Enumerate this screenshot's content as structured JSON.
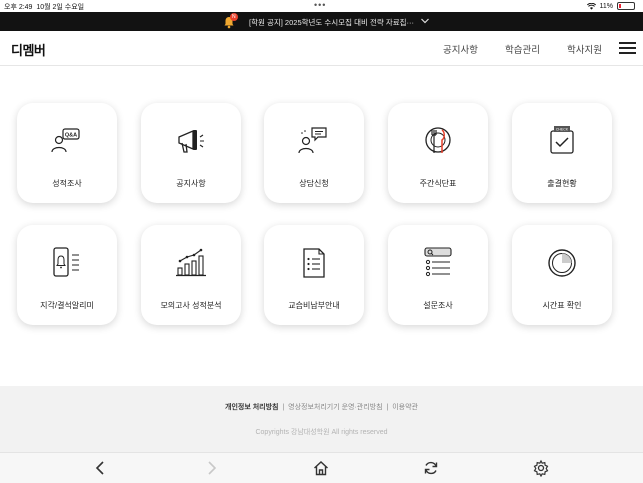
{
  "status_bar": {
    "time": "오후 2:49",
    "date": "10월 2일 수요일",
    "dots": "•••",
    "battery": "11%"
  },
  "notice": {
    "badge": "N",
    "text": "[학원 공지] 2025학년도 수시모집 대비 전략 자료집···"
  },
  "header": {
    "logo": "디멤버",
    "nav": [
      "공지사항",
      "학습관리",
      "학사지원"
    ]
  },
  "tiles": [
    {
      "label": "성적조사",
      "icon": "qna-person-icon"
    },
    {
      "label": "공지사항",
      "icon": "megaphone-icon"
    },
    {
      "label": "상담신청",
      "icon": "chat-person-icon"
    },
    {
      "label": "주간식단표",
      "icon": "meal-plate-icon"
    },
    {
      "label": "출결현황",
      "icon": "check-clipboard-icon"
    },
    {
      "label": "지각/결석알리미",
      "icon": "phone-bell-icon"
    },
    {
      "label": "모의고사 성적분석",
      "icon": "bar-chart-icon"
    },
    {
      "label": "교습비납부안내",
      "icon": "document-list-icon"
    },
    {
      "label": "설문조사",
      "icon": "survey-list-icon"
    },
    {
      "label": "시간표 확인",
      "icon": "clock-circle-icon"
    }
  ],
  "footer": {
    "privacy": "개인정보 처리방침",
    "cctv": "영상정보처리기기 운영·관리방침",
    "terms": "이용약관",
    "copyright": "Copyrights 강남대성학원 All rights reserved"
  },
  "colors": {
    "accent": "#e8412c",
    "notice_bg": "#121212"
  }
}
